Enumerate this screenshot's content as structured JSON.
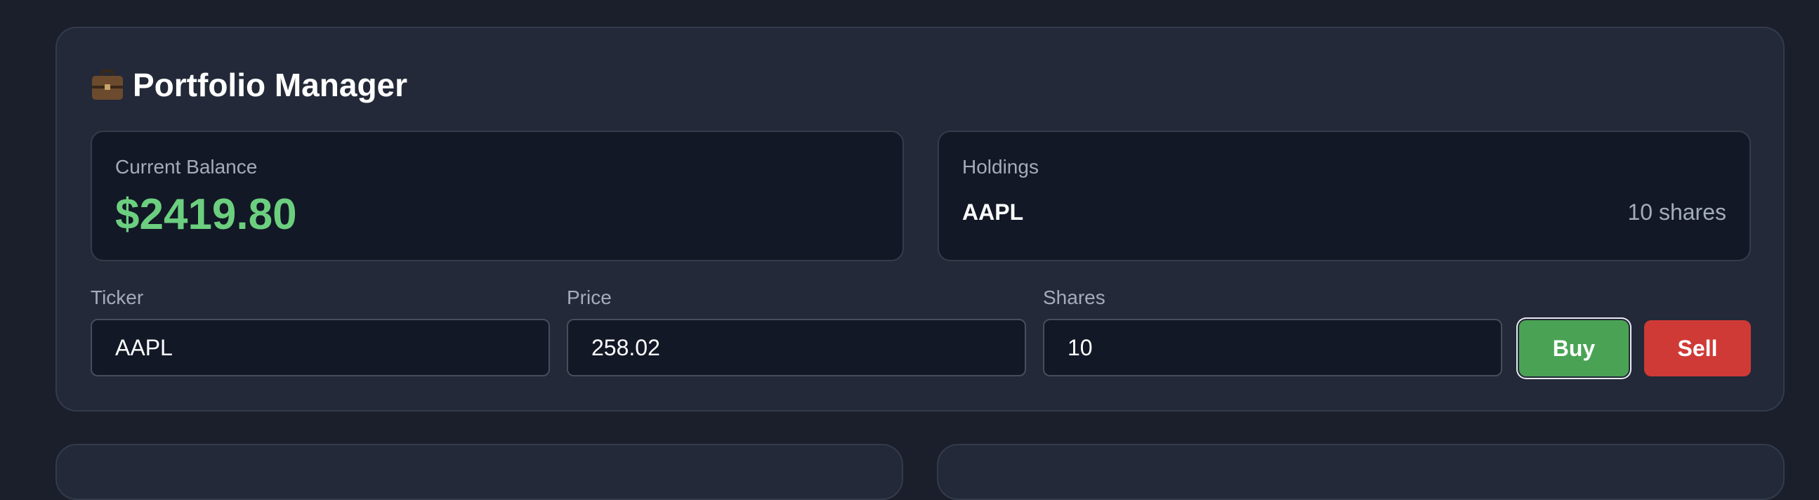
{
  "app": {
    "title": "Portfolio Manager",
    "title_icon": "briefcase-icon"
  },
  "balance": {
    "label": "Current Balance",
    "value": "$2419.80",
    "color": "#6ccf7f"
  },
  "holdings": {
    "label": "Holdings",
    "items": [
      {
        "ticker": "AAPL",
        "shares": "10 shares"
      }
    ]
  },
  "form": {
    "ticker": {
      "label": "Ticker",
      "value": "AAPL"
    },
    "price": {
      "label": "Price",
      "value": "258.02"
    },
    "shares": {
      "label": "Shares",
      "value": "10"
    }
  },
  "actions": {
    "buy_label": "Buy",
    "sell_label": "Sell",
    "buy_color": "#4aa355",
    "sell_color": "#cf3a36"
  }
}
